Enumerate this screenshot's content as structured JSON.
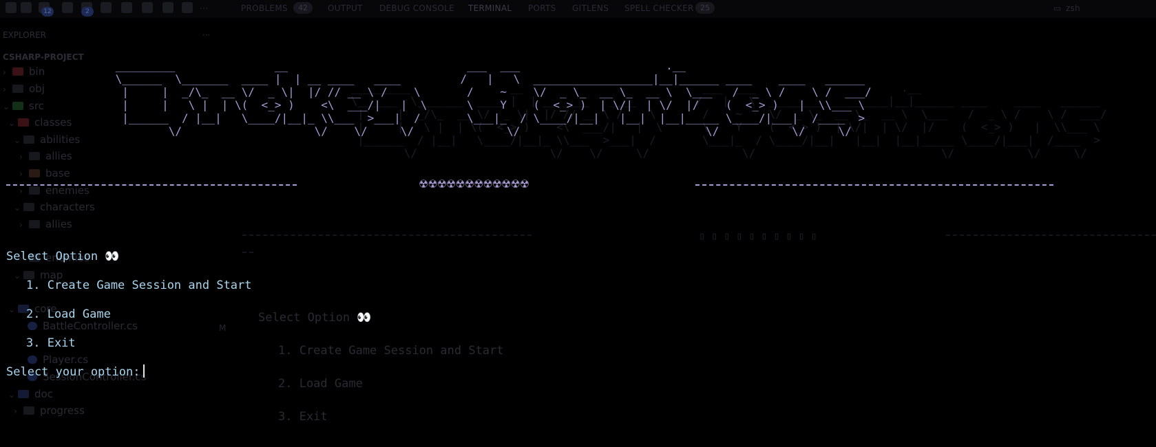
{
  "activity_badges": [
    "12",
    "2"
  ],
  "panel_tabs": {
    "problems": "PROBLEMS",
    "problems_count": "42",
    "output": "OUTPUT",
    "debug_console": "DEBUG CONSOLE",
    "terminal": "TERMINAL",
    "ports": "PORTS",
    "gitlens": "GITLENS",
    "spell_checker": "SPELL CHECKER",
    "spell_checker_count": "25",
    "shell": "zsh"
  },
  "explorer": {
    "title": "EXPLORER",
    "more": "···",
    "project": "CSHARP-PROJECT",
    "items": [
      {
        "label": "bin"
      },
      {
        "label": "obj"
      },
      {
        "label": "src"
      },
      {
        "label": "classes"
      },
      {
        "label": "abilities"
      },
      {
        "label": "allies"
      },
      {
        "label": "base"
      },
      {
        "label": "enemies"
      },
      {
        "label": "characters"
      },
      {
        "label": "allies"
      },
      {
        "label": "enemies"
      },
      {
        "label": "map"
      },
      {
        "label": "core"
      },
      {
        "label": "BattleController.cs"
      },
      {
        "label": "Player.cs"
      },
      {
        "label": "SessionController.cs"
      },
      {
        "label": "doc"
      },
      {
        "label": "progress"
      }
    ],
    "modified_mark": "M"
  },
  "terminal": {
    "banner_art": " _________               __                           ___  ___                      .__\n \\______  \\_______  ____ |  | __ ____   ____         /   |   \\  __________________|__|______ ____    ____   ______\n  |     |  _/\\_  __ \\/  _ \\|  |/ // __ \\ /    \\       /    ~    \\/  _ \\_  __ \\_  __ \\  \\___   /  _ \\ /    \\ /  ___/\n  |     |   \\ |  | \\(  <_> )    <\\  ___/|   |  \\      \\    Y    (  <_> )  | \\/|  | \\/  |/    (  <_> )   |  \\\\___ \\\n  |______  / |__|   \\____/|__|_ \\\\___  >___|  /       \\___|_  / \\____/|__|   |__|  |__|_____ \\____/|___|  /____  >\n         \\/                    \\/    \\/     \\/              \\/                            \\/           \\/     \\/",
    "radiation": "☢☢☢☢☢☢☢☢☢☢☢☢",
    "select_heading": "Select Option 👀",
    "options": [
      "1. Create Game Session and Start",
      "2. Load Game",
      "3. Exit"
    ],
    "prompt": "Select your option:"
  },
  "ghost_terminal": {
    "select_heading": "Select Option 👀",
    "options": [
      "1. Create Game Session and Start",
      "2. Load Game",
      "3. Exit"
    ],
    "boxes": "▯ ▯ ▯ ▯ ▯ ▯ ▯ ▯ ▯ ▯"
  },
  "colors": {
    "banner": "#a89bd4",
    "menu_text": "#a9d5ee",
    "background": "#000000"
  }
}
